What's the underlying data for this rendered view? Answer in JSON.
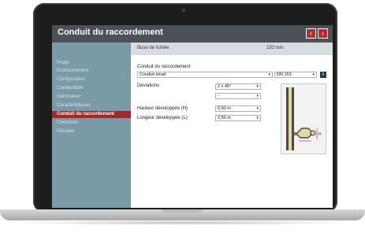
{
  "app": {
    "title": "Conduit du raccordement"
  },
  "nav": {
    "prev_icon": "chevron-left-icon",
    "next_icon": "chevron-right-icon",
    "prev_glyph": "‹",
    "next_glyph": "›"
  },
  "sidebar": {
    "items": [
      {
        "label": "Projet"
      },
      {
        "label": "Environnement"
      },
      {
        "label": "Configuration"
      },
      {
        "label": "Combustible"
      },
      {
        "label": "Générateur"
      },
      {
        "label": "Caractéristiques"
      },
      {
        "label": "Conduit du raccordement"
      },
      {
        "label": "Cheminée"
      },
      {
        "label": "Résultat"
      }
    ],
    "active_index": 6
  },
  "summary": {
    "label": "Buse de fumée",
    "value": "153 mm"
  },
  "form": {
    "section_label": "Conduit du raccordement",
    "conduit_type": {
      "value": "Conduit émail"
    },
    "diameter": {
      "value": "DN 153"
    },
    "info_glyph": "i",
    "deviations": {
      "label": "Déviations",
      "value_1": "2 x 45°",
      "value_2": "-"
    },
    "height": {
      "label": "Hauteur développée (H)",
      "value": "0,90 m"
    },
    "length": {
      "label": "Longeur développée (L)",
      "value": "2,50 m"
    }
  },
  "diagram": {
    "label_l": "L",
    "label_h": "H"
  },
  "colors": {
    "header": "#4a5257",
    "sidebar": "#7a9aa8",
    "active": "#a8262b",
    "accent_red": "#c3262e"
  }
}
